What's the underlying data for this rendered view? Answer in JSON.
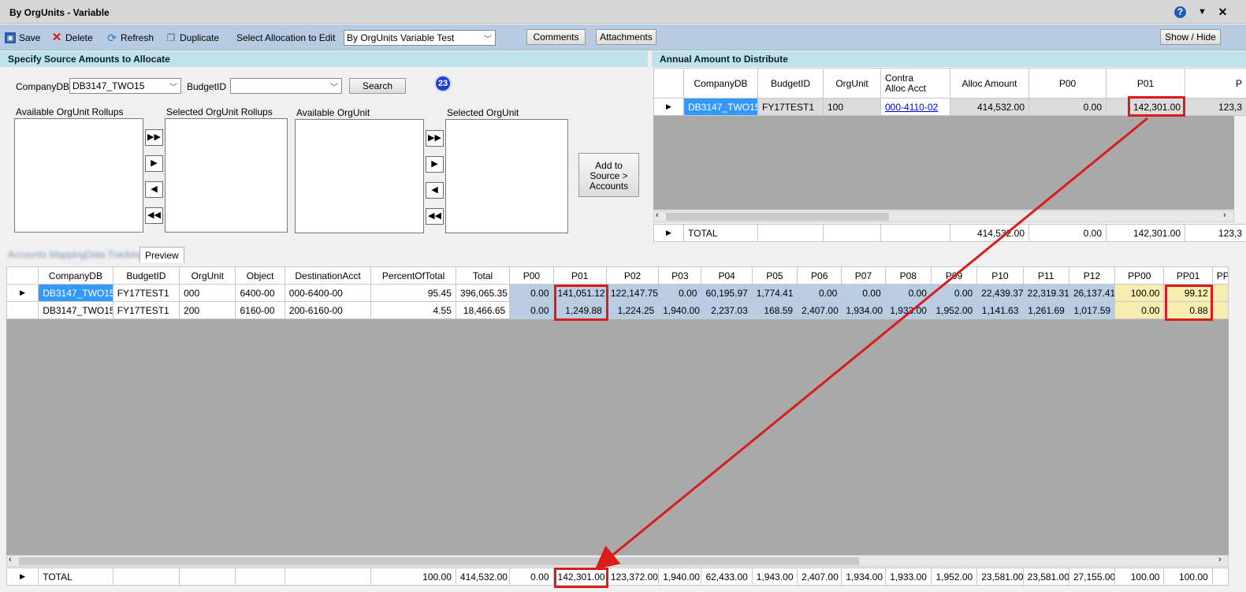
{
  "window": {
    "title": "By OrgUnits - Variable"
  },
  "toolbar": {
    "save": "Save",
    "delete": "Delete",
    "refresh": "Refresh",
    "duplicate": "Duplicate",
    "select_label": "Select Allocation to Edit",
    "select_value": "By OrgUnits Variable Test",
    "comments": "Comments",
    "attachments": "Attachments",
    "show_hide": "Show / Hide"
  },
  "source": {
    "header": "Specify Source Amounts to Allocate",
    "company_label": "CompanyDB",
    "company_value": "DB3147_TWO15",
    "budget_label": "BudgetID",
    "budget_value": "",
    "search": "Search",
    "badge": "23",
    "avail_rollups": "Available OrgUnit Rollups",
    "sel_rollups": "Selected OrgUnit Rollups",
    "avail_org": "Available OrgUnit",
    "sel_org": "Selected OrgUnit",
    "add_btn_l1": "Add to",
    "add_btn_l2": "Source  >",
    "add_btn_l3": "Accounts"
  },
  "annual": {
    "header": "Annual Amount to Distribute",
    "columns": [
      "CompanyDB",
      "BudgetID",
      "OrgUnit",
      "Contra",
      "Alloc Acct",
      "Alloc Amount",
      "P00",
      "P01",
      "P"
    ],
    "row": {
      "company": "DB3147_TWO15",
      "budget": "FY17TEST1",
      "org": "100",
      "contra": "000-4110-02",
      "alloc": "414,532.00",
      "p00": "0.00",
      "p01": "142,301.00",
      "p02": "123,3"
    },
    "total": {
      "label": "TOTAL",
      "alloc": "414,532.00",
      "p00": "0.00",
      "p01": "142,301.00",
      "p02": "123,3"
    }
  },
  "tabs": {
    "t1": "Accounts Mapping",
    "t2": "Data Tracking",
    "t3": "Preview"
  },
  "preview": {
    "columns": [
      "CompanyDB",
      "BudgetID",
      "OrgUnit",
      "Object",
      "DestinationAcct",
      "PercentOfTotal",
      "Total",
      "P00",
      "P01",
      "P02",
      "P03",
      "P04",
      "P05",
      "P06",
      "P07",
      "P08",
      "P09",
      "P10",
      "P11",
      "P12",
      "PP00",
      "PP01",
      "PP"
    ],
    "rows": [
      [
        "DB3147_TWO15",
        "FY17TEST1",
        "000",
        "6400-00",
        "000-6400-00",
        "95.45",
        "396,065.35",
        "0.00",
        "141,051.12",
        "122,147.75",
        "0.00",
        "60,195.97",
        "1,774.41",
        "0.00",
        "0.00",
        "0.00",
        "0.00",
        "22,439.37",
        "22,319.31",
        "26,137.41",
        "100.00",
        "99.12"
      ],
      [
        "DB3147_TWO15",
        "FY17TEST1",
        "200",
        "6160-00",
        "200-6160-00",
        "4.55",
        "18,466.65",
        "0.00",
        "1,249.88",
        "1,224.25",
        "1,940.00",
        "2,237.03",
        "168.59",
        "2,407.00",
        "1,934.00",
        "1,933.00",
        "1,952.00",
        "1,141.63",
        "1,261.69",
        "1,017.59",
        "0.00",
        "0.88"
      ]
    ],
    "total": [
      "TOTAL",
      "",
      "",
      "",
      "",
      "100.00",
      "414,532.00",
      "0.00",
      "142,301.00",
      "123,372.00",
      "1,940.00",
      "62,433.00",
      "1,943.00",
      "2,407.00",
      "1,934.00",
      "1,933.00",
      "1,952.00",
      "23,581.00",
      "23,581.00",
      "27,155.00",
      "100.00",
      "100.00"
    ]
  },
  "colors": {
    "highlight": "#d91c1c",
    "selected": "#3399ff",
    "period": "#b8cce4",
    "pct": "#f5eeb0"
  }
}
